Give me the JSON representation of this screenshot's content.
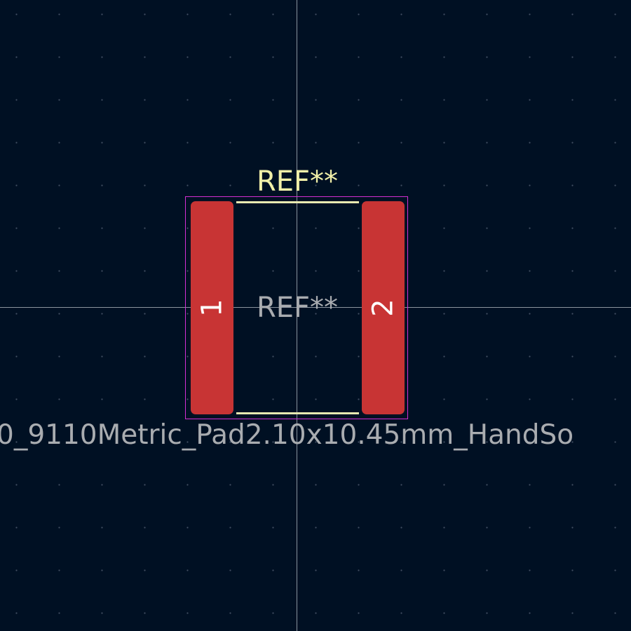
{
  "footprint": {
    "reference_silkscreen": "REF**",
    "reference_fab": "REF**",
    "value": "0_9110Metric_Pad2.10x10.45mm_HandSo",
    "pads": [
      {
        "number": "1"
      },
      {
        "number": "2"
      }
    ]
  },
  "colors": {
    "background": "#001023",
    "pad": "#c83434",
    "silkscreen": "#f2f0a8",
    "fab_text": "#a9acb0",
    "courtyard": "#d42fd4",
    "crosshair": "#b8bfc8"
  }
}
